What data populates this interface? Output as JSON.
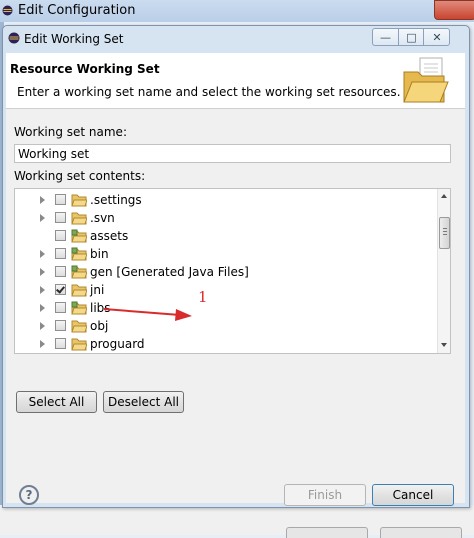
{
  "parent_window": {
    "title": "Edit Configuration"
  },
  "dialog": {
    "title": "Edit Working Set",
    "header_title": "Resource Working Set",
    "header_description": "Enter a working set name and select the working set resources.",
    "name_label": "Working set name:",
    "name_value": "Working set",
    "contents_label": "Working set contents:"
  },
  "tree": {
    "items": [
      {
        "label": ".settings",
        "checked": false,
        "expandable": true,
        "icon": "folder-icon"
      },
      {
        "label": ".svn",
        "checked": false,
        "expandable": true,
        "icon": "folder-icon"
      },
      {
        "label": "assets",
        "checked": false,
        "expandable": false,
        "icon": "source-folder-icon"
      },
      {
        "label": "bin",
        "checked": false,
        "expandable": true,
        "icon": "source-folder-icon"
      },
      {
        "label": "gen [Generated Java Files]",
        "checked": false,
        "expandable": true,
        "icon": "source-folder-icon"
      },
      {
        "label": "jni",
        "checked": true,
        "expandable": true,
        "icon": "folder-icon"
      },
      {
        "label": "libs",
        "checked": false,
        "expandable": true,
        "icon": "source-folder-icon"
      },
      {
        "label": "obj",
        "checked": false,
        "expandable": true,
        "icon": "folder-icon"
      },
      {
        "label": "proguard",
        "checked": false,
        "expandable": true,
        "icon": "folder-icon"
      }
    ]
  },
  "buttons": {
    "select_all": "Select All",
    "deselect_all": "Deselect All",
    "finish": "Finish",
    "cancel": "Cancel"
  },
  "help": {
    "glyph": "?"
  },
  "annotation": {
    "number": "1",
    "color": "#d92b2b"
  },
  "colors": {
    "dialog_border": "#7f93ad",
    "cancel_focus": "#3c7fb1"
  }
}
